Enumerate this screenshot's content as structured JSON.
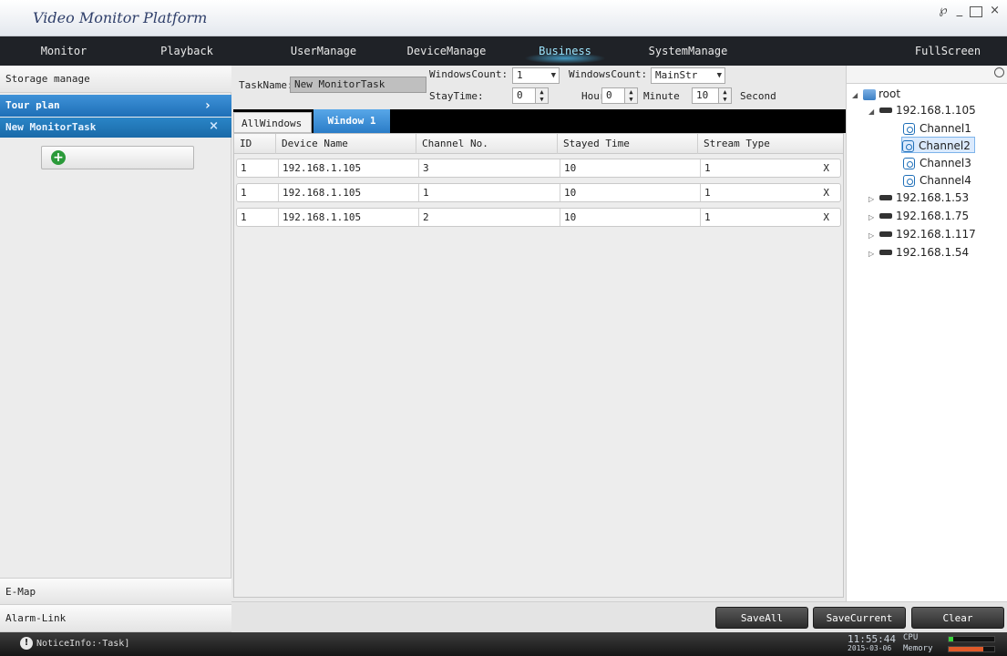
{
  "app": {
    "title": "Video Monitor Platform"
  },
  "window_controls": {
    "settings": "℘",
    "minimize": "_",
    "close": "×"
  },
  "menu": [
    "Monitor",
    "Playback",
    "UserManage",
    "DeviceManage",
    "Business",
    "SystemManage",
    "FullScreen"
  ],
  "sidebar": {
    "storage": "Storage manage",
    "tour_plan": "Tour plan",
    "tour_chevron": "›",
    "task": "New MonitorTask",
    "task_close": "×",
    "add_icon": "+",
    "emap": "E-Map",
    "alarm": "Alarm-Link"
  },
  "form": {
    "taskname_label": "TaskName:",
    "taskname_value": "New MonitorTask",
    "windowscount_label": "WindowsCount:",
    "windowscount_value": "1",
    "windowscount2_label": "WindowsCount:",
    "stream_value": "MainStr",
    "staytime_label": "StayTime:",
    "hour_value": "0",
    "hour_label": "Hour",
    "minute_value": "0",
    "minute_label": "Minute",
    "second_value": "10",
    "second_label": "Second",
    "dd_arrow": "▼",
    "spin_up": "▲",
    "spin_down": "▼"
  },
  "tabs": {
    "all": "AllWindows",
    "window1": "Window 1"
  },
  "table": {
    "headers": [
      "ID",
      "Device Name",
      "Channel No.",
      "Stayed Time",
      "Stream Type"
    ],
    "rows": [
      [
        "1",
        "192.168.1.105",
        "3",
        "10",
        "1"
      ],
      [
        "1",
        "192.168.1.105",
        "1",
        "10",
        "1"
      ],
      [
        "1",
        "192.168.1.105",
        "2",
        "10",
        "1"
      ]
    ],
    "delete_label": "X"
  },
  "tree": {
    "root": "root",
    "expanded": "◢",
    "collapsed": "▷",
    "devices": [
      "192.168.1.105",
      "192.168.1.53",
      "192.168.1.75",
      "192.168.1.117",
      "192.168.1.54"
    ],
    "channels": [
      "Channel1",
      "Channel2",
      "Channel3",
      "Channel4"
    ],
    "selected_channel": "Channel2"
  },
  "actions": {
    "save_all": "SaveAll",
    "save_current": "SaveCurrent",
    "clear": "Clear"
  },
  "status": {
    "notice": "NoticeInfo:·Task]",
    "info_icon": "!",
    "time": "11:55:44",
    "date": "2015-03-06",
    "cpu_label": "CPU",
    "memory_label": "Memory",
    "cpu_level": 0.1,
    "memory_level": 0.75,
    "cpu_color": "#39d33c",
    "memory_color": "#e05a2a"
  },
  "colors": {
    "accent": "#2a7cc7",
    "menu_bg": "#1f2227",
    "active_menu": "#9fe7ff"
  }
}
